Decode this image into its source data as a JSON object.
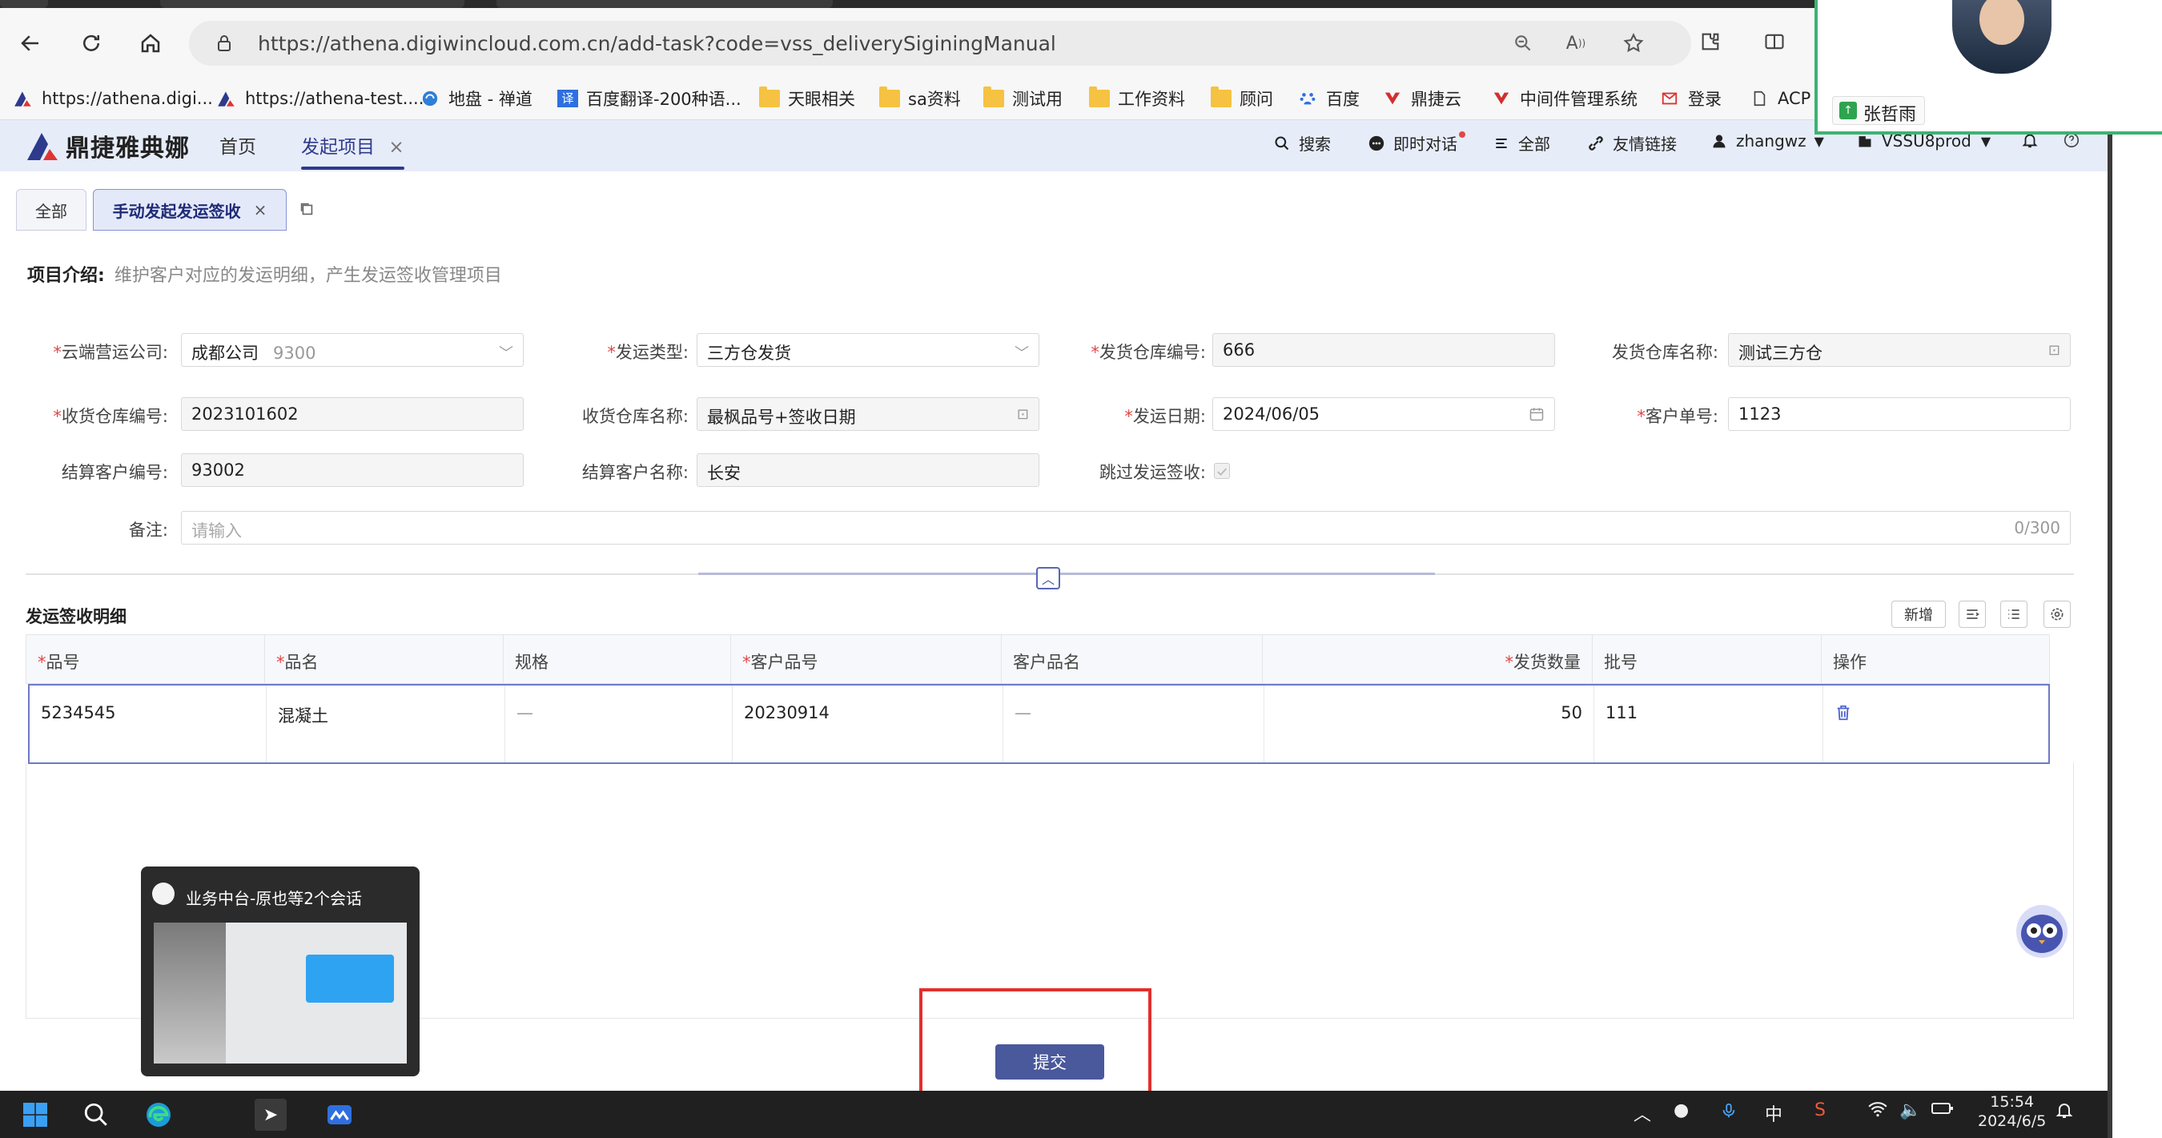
{
  "browser": {
    "url": "https://athena.digiwincloud.com.cn/add-task?code=vss_deliverySiginingManual",
    "bookmarks": [
      {
        "label": "https://athena.digi...",
        "icon": "athena-logo-icon"
      },
      {
        "label": "https://athena-test....",
        "icon": "athena-logo-icon"
      },
      {
        "label": "地盘 - 禅道",
        "icon": "zentao-icon"
      },
      {
        "label": "百度翻译-200种语...",
        "icon": "baidu-translate-icon"
      },
      {
        "label": "天眼相关",
        "icon": "folder-icon"
      },
      {
        "label": "sa资料",
        "icon": "folder-icon"
      },
      {
        "label": "测试用",
        "icon": "folder-icon"
      },
      {
        "label": "工作资料",
        "icon": "folder-icon"
      },
      {
        "label": "顾问",
        "icon": "folder-icon"
      },
      {
        "label": "百度",
        "icon": "baidu-icon"
      },
      {
        "label": "鼎捷云",
        "icon": "digiwin-icon"
      },
      {
        "label": "中间件管理系统",
        "icon": "digiwin-icon"
      },
      {
        "label": "登录",
        "icon": "login-icon"
      },
      {
        "label": "ACP",
        "icon": "page-icon"
      }
    ]
  },
  "app": {
    "logo_text": "鼎捷雅典娜",
    "nav": {
      "home": "首页",
      "launch": "发起项目",
      "close": "×"
    },
    "tools": {
      "search": "搜索",
      "chat": "即时对话",
      "all": "全部",
      "links": "友情链接",
      "user": "zhangwz",
      "env": "VSSU8prod"
    }
  },
  "tabs": [
    {
      "label": "全部"
    },
    {
      "label": "手动发起发运签收",
      "close": "×"
    }
  ],
  "intro": {
    "label": "项目介绍:",
    "desc": "维护客户对应的发运明细，产生发运签收管理项目"
  },
  "form": {
    "cloud_company": {
      "label": "云端营运公司:",
      "value": "成都公司",
      "sub": "9300"
    },
    "ship_type": {
      "label": "发运类型:",
      "value": "三方仓发货"
    },
    "ship_wh_no": {
      "label": "发货仓库编号:",
      "value": "666"
    },
    "ship_wh_name": {
      "label": "发货仓库名称:",
      "value": "测试三方仓"
    },
    "recv_wh_no": {
      "label": "收货仓库编号:",
      "value": "2023101602"
    },
    "recv_wh_name": {
      "label": "收货仓库名称:",
      "value": "最枫品号+签收日期"
    },
    "ship_date": {
      "label": "发运日期:",
      "value": "2024/06/05"
    },
    "customer_no": {
      "label": "客户单号:",
      "value": "1123"
    },
    "settle_no": {
      "label": "结算客户编号:",
      "value": "93002"
    },
    "settle_name": {
      "label": "结算客户名称:",
      "value": "长安"
    },
    "skip_sign": {
      "label": "跳过发运签收:"
    },
    "remark": {
      "label": "备注:",
      "placeholder": "请输入",
      "counter": "0/300"
    }
  },
  "detail": {
    "title": "发运签收明细",
    "add_label": "新增",
    "columns": {
      "item_no": "品号",
      "item_name": "品名",
      "spec": "规格",
      "cust_item_no": "客户品号",
      "cust_item_name": "客户品名",
      "qty": "发货数量",
      "batch": "批号",
      "action": "操作"
    },
    "rows": [
      {
        "item_no": "5234545",
        "item_name": "混凝土",
        "spec": "—",
        "cust_item_no": "20230914",
        "cust_item_name": "—",
        "qty": "50",
        "batch": "111"
      }
    ]
  },
  "submit_label": "提交",
  "preview": {
    "title": "业务中台-原也等2个会话"
  },
  "call": {
    "name": "张哲雨"
  },
  "taskbar": {
    "ime": "中",
    "time": "15:54",
    "date": "2024/6/5"
  },
  "colors": {
    "primary": "#4a589c",
    "accent_border": "#6f79c8",
    "required": "#e04848",
    "highlight_box": "#e0302e",
    "call_border": "#3cb371"
  }
}
